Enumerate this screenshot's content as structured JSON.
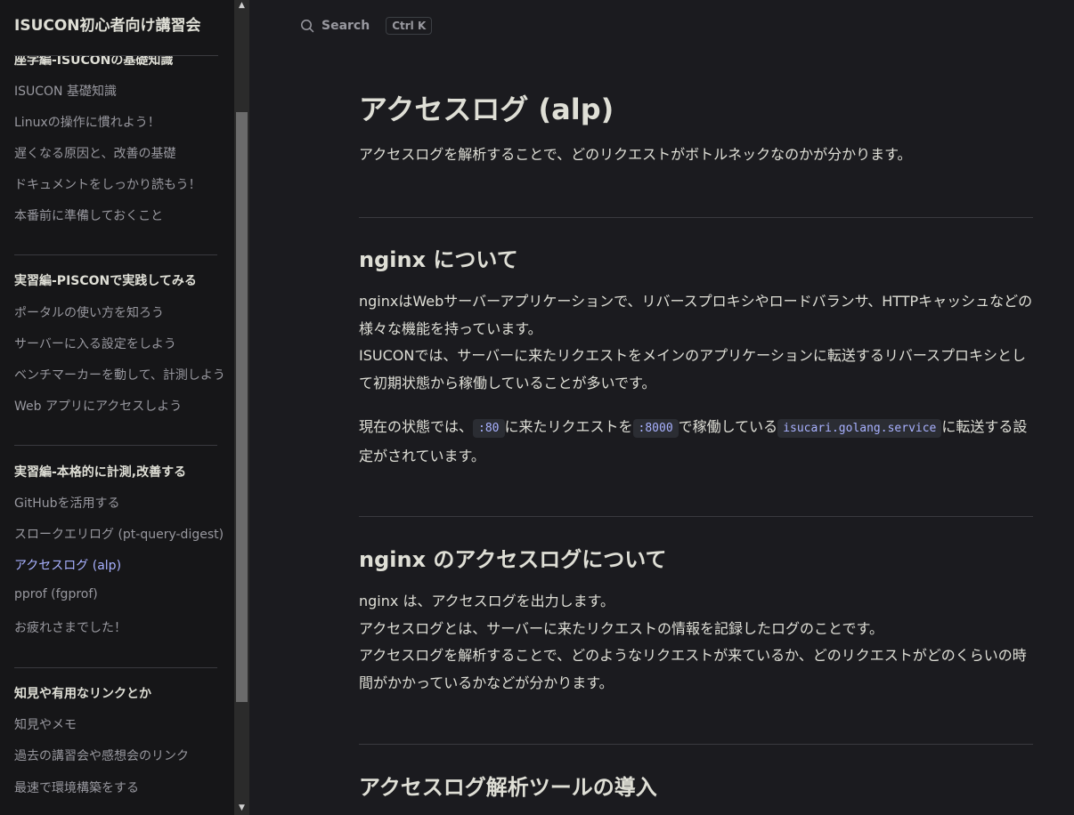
{
  "sidebar": {
    "title": "ISUCON初心者向け講習会",
    "groups": [
      {
        "title": "座学編-ISUCONの基礎知識",
        "items": [
          "ISUCON 基礎知識",
          "Linuxの操作に慣れよう！",
          "遅くなる原因と、改善の基礎",
          "ドキュメントをしっかり読もう！",
          "本番前に準備しておくこと"
        ]
      },
      {
        "title": "実習編-PISCONで実践してみる",
        "items": [
          "ポータルの使い方を知ろう",
          "サーバーに入る設定をしよう",
          "ベンチマーカーを動して、計測しよう",
          "Web アプリにアクセスしよう"
        ]
      },
      {
        "title": "実習編-本格的に計測,改善する",
        "items": [
          "GitHubを活用する",
          "スロークエリログ (pt-query-digest)",
          "アクセスログ (alp)",
          "pprof (fgprof)",
          "お疲れさまでした！"
        ]
      },
      {
        "title": "知見や有用なリンクとか",
        "items": [
          "知見やメモ",
          "過去の講習会や感想会のリンク",
          "最速で環境構築をする"
        ]
      }
    ]
  },
  "search": {
    "label": "Search",
    "shortcut": "Ctrl K"
  },
  "article": {
    "title": "アクセスログ (alp)",
    "intro": "アクセスログを解析することで、どのリクエストがボトルネックなのかが分かります。",
    "sections": [
      {
        "heading": "nginx について",
        "p1": "nginxはWebサーバーアプリケーションで、リバースプロキシやロードバランサ、HTTPキャッシュなどの様々な機能を持っています。",
        "p2": "ISUCONでは、サーバーに来たリクエストをメインのアプリケーションに転送するリバースプロキシとして初期状態から稼働していることが多いです。",
        "p3_a": "現在の状態では、",
        "p3_code1": ":80",
        "p3_b": "に来たリクエストを",
        "p3_code2": ":8000",
        "p3_c": "で稼働している",
        "p3_code3": "isucari.golang.service",
        "p3_d": "に転送する設定がされています。"
      },
      {
        "heading": "nginx のアクセスログについて",
        "p1": "nginx は、アクセスログを出力します。",
        "p2": "アクセスログとは、サーバーに来たリクエストの情報を記録したログのことです。",
        "p3": "アクセスログを解析することで、どのようなリクエストが来ているか、どのリクエストがどのくらいの時間がかかっているかなどが分かります。"
      },
      {
        "heading": "アクセスログ解析ツールの導入"
      }
    ]
  },
  "colors": {
    "active": "#a8b1ff",
    "background": "#1b1b1f",
    "sidebar": "#161618"
  }
}
